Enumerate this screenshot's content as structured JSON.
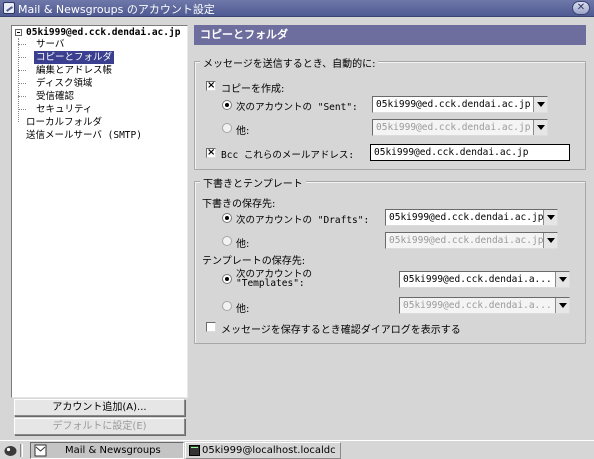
{
  "window": {
    "title": "Mail & Newsgroups のアカウント設定"
  },
  "sidebar": {
    "account": "05ki999@ed.cck.dendai.ac.jp",
    "items": [
      {
        "label": "サーバ"
      },
      {
        "label": "コピーとフォルダ"
      },
      {
        "label": "編集とアドレス帳"
      },
      {
        "label": "ディスク領域"
      },
      {
        "label": "受信確認"
      },
      {
        "label": "セキュリティ"
      }
    ],
    "local_folders": "ローカルフォルダ",
    "smtp": "送信メールサーバ (SMTP)",
    "add_account": "アカウント追加(A)...",
    "set_default": "デフォルトに設定(E)"
  },
  "panel": {
    "title": "コピーとフォルダ",
    "send_group": {
      "legend": "メッセージを送信するとき、自動的に:",
      "copy_label": "コピーを作成:",
      "copy_checked": true,
      "sent_account_label": "次のアカウントの \"Sent\":",
      "sent_account_value": "05ki999@ed.cck.dendai.ac.jp",
      "other_label": "他:",
      "other_value": "05ki999@ed.cck.dendai.ac.jp",
      "bcc_label": "Bcc これらのメールアドレス:",
      "bcc_checked": true,
      "bcc_value": "05ki999@ed.cck.dendai.ac.jp"
    },
    "drafts_group": {
      "legend": "下書きとテンプレート",
      "drafts_heading": "下書きの保存先:",
      "drafts_account_label": "次のアカウントの \"Drafts\":",
      "drafts_account_value": "05ki999@ed.cck.dendai.ac.jp",
      "drafts_other_label": "他:",
      "drafts_other_value": "05ki999@ed.cck.dendai.ac.jp",
      "templates_heading": "テンプレートの保存先:",
      "templates_account_label_1": "次のアカウントの",
      "templates_account_label_2": "\"Templates\":",
      "templates_account_value": "05ki999@ed.cck.dendai.a...",
      "templates_other_label": "他:",
      "templates_other_value": "05ki999@ed.cck.dendai.a...",
      "confirm_label": "メッセージを保存するとき確認ダイアログを表示する",
      "confirm_checked": false
    }
  },
  "taskbar": {
    "task1": "Mail & Newsgroups",
    "task2": "05ki999@localhost.localdc"
  }
}
